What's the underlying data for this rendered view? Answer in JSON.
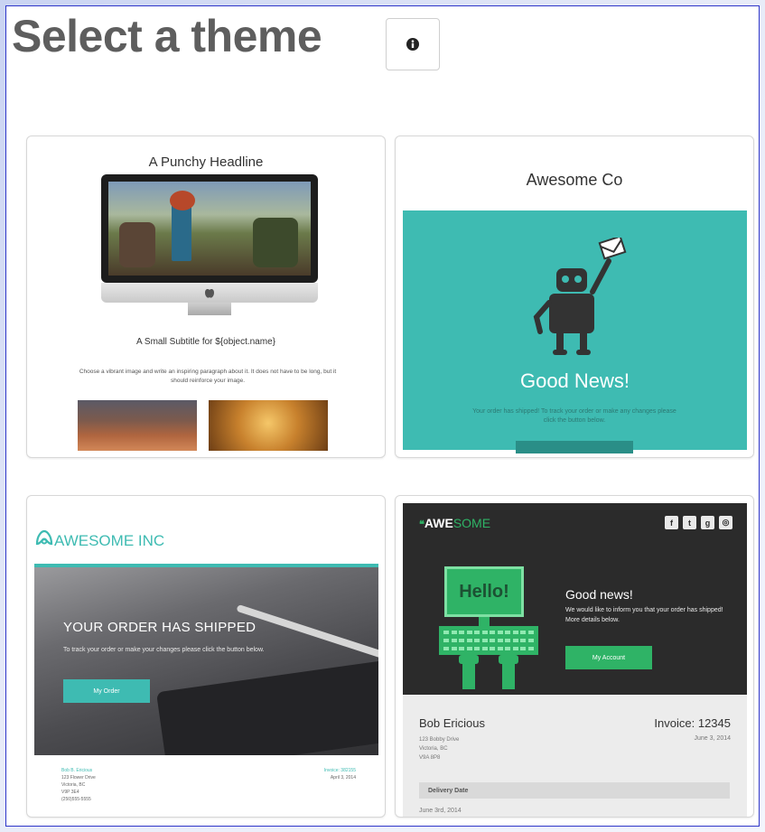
{
  "page": {
    "title": "Select a theme",
    "info_icon": "info-circle-icon"
  },
  "themes": [
    {
      "headline": "A Punchy Headline",
      "subtitle": "A Small Subtitle for ${object.name}",
      "paragraph": "Choose a vibrant image and write an inspiring paragraph about it. It does not have to be long, but it should reinforce your image."
    },
    {
      "brand": "Awesome Co",
      "headline": "Good News!",
      "body": "Your order has shipped! To track your order or make any changes please click the button below."
    },
    {
      "brand": "AWESOME INC",
      "headline": "YOUR ORDER HAS SHIPPED",
      "body": "To track your order or make your changes please click the button below.",
      "button": "My Order",
      "footer_left": [
        "Bob B. Ericious",
        "123 Flower Drive",
        "Victoria, BC",
        "V9P 3E4",
        "(250)555-5555"
      ],
      "footer_right": [
        "Invoice: 382155",
        "April 3, 2014"
      ]
    },
    {
      "brand_a": "AWE",
      "brand_b": "SOME",
      "social_icons": [
        "facebook-icon",
        "twitter-icon",
        "google-plus-icon",
        "instagram-icon"
      ],
      "monitor_text": "Hello!",
      "headline": "Good news!",
      "body": "We would like to inform you that your order has shipped! More details below.",
      "button": "My Account",
      "name": "Bob Ericious",
      "address": [
        "123 Bobby Drive",
        "Victoria, BC",
        "V9A 8P8"
      ],
      "invoice": "Invoice: 12345",
      "date": "June 3, 2014",
      "delivery_label": "Delivery Date",
      "delivery_value": "June 3rd, 2014"
    }
  ],
  "colors": {
    "teal": "#3ebbb2",
    "green": "#2fb366",
    "dark": "#2b2b2b"
  }
}
